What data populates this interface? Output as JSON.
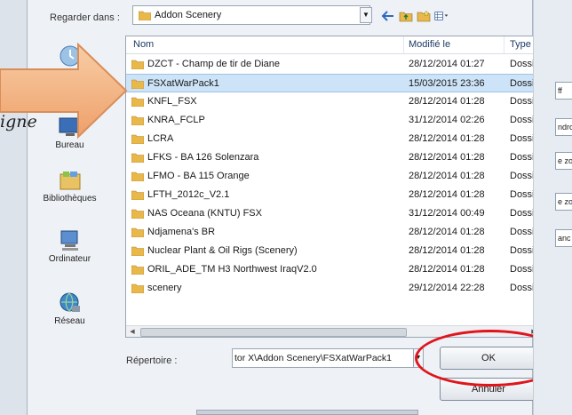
{
  "dialog": {
    "look_in_label": "Regarder dans :",
    "look_in_value": "Addon Scenery"
  },
  "places": [
    {
      "label": "Bureau",
      "icon": "desktop-icon"
    },
    {
      "label": "Bibliothèques",
      "icon": "libraries-icon"
    },
    {
      "label": "Ordinateur",
      "icon": "computer-icon"
    },
    {
      "label": "Réseau",
      "icon": "network-icon"
    }
  ],
  "columns": {
    "name": "Nom",
    "modified": "Modifié le",
    "type": "Type"
  },
  "files": [
    {
      "name": "DZCT - Champ de tir de Diane",
      "modified": "28/12/2014 01:27",
      "type": "Dossier de fichiers"
    },
    {
      "name": "FSXatWarPack1",
      "modified": "15/03/2015 23:36",
      "type": "Dossier de fichiers",
      "selected": true
    },
    {
      "name": "KNFL_FSX",
      "modified": "28/12/2014 01:28",
      "type": "Dossier de fichiers"
    },
    {
      "name": "KNRA_FCLP",
      "modified": "31/12/2014 02:26",
      "type": "Dossier de fichiers"
    },
    {
      "name": "LCRA",
      "modified": "28/12/2014 01:28",
      "type": "Dossier de fichiers"
    },
    {
      "name": "LFKS - BA 126 Solenzara",
      "modified": "28/12/2014 01:28",
      "type": "Dossier de fichiers"
    },
    {
      "name": "LFMO - BA 115 Orange",
      "modified": "28/12/2014 01:28",
      "type": "Dossier de fichiers"
    },
    {
      "name": "LFTH_2012c_V2.1",
      "modified": "28/12/2014 01:28",
      "type": "Dossier de fichiers"
    },
    {
      "name": "NAS Oceana (KNTU) FSX",
      "modified": "31/12/2014 00:49",
      "type": "Dossier de fichiers"
    },
    {
      "name": "Ndjamena's BR",
      "modified": "28/12/2014 01:28",
      "type": "Dossier de fichiers"
    },
    {
      "name": "Nuclear Plant & Oil Rigs (Scenery)",
      "modified": "28/12/2014 01:28",
      "type": "Dossier de fichiers"
    },
    {
      "name": "ORIL_ADE_TM H3 Northwest IraqV2.0",
      "modified": "28/12/2014 01:28",
      "type": "Dossier de fichiers"
    },
    {
      "name": "scenery",
      "modified": "29/12/2014 22:28",
      "type": "Dossier de fichiers"
    }
  ],
  "bottom": {
    "directory_label": "Répertoire :",
    "directory_value": "tor X\\Addon Scenery\\FSXatWarPack1",
    "ok_label": "OK",
    "cancel_label": "Annuler"
  },
  "annotation": {
    "callout_text": "igne",
    "arrow_color": "#f2b07a",
    "ring_color": "#e0141c"
  },
  "side_panel": {
    "fields": [
      "ff",
      "ndro",
      "e zo",
      "e zo",
      "anc"
    ]
  }
}
